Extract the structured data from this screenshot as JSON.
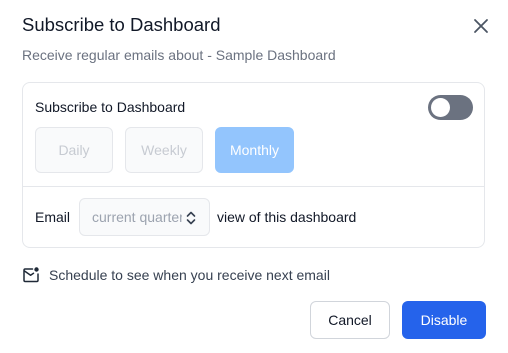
{
  "dialog": {
    "title": "Subscribe to Dashboard",
    "subtitle": "Receive regular emails about - Sample Dashboard",
    "close_icon": "close-icon"
  },
  "subscription": {
    "label": "Subscribe to Dashboard",
    "toggle_on": false,
    "frequency_options": [
      "Daily",
      "Weekly",
      "Monthly"
    ],
    "selected_frequency": "Monthly"
  },
  "email_row": {
    "label": "Email",
    "select_value": "current quarter",
    "suffix": "view of this dashboard"
  },
  "schedule": {
    "icon": "mail-calendar-icon",
    "text": "Schedule to see when you receive next email"
  },
  "actions": {
    "cancel_label": "Cancel",
    "disable_label": "Disable"
  },
  "colors": {
    "primary": "#2563eb",
    "selected_option": "#93c5fd",
    "toggle_off": "#6b7280"
  }
}
